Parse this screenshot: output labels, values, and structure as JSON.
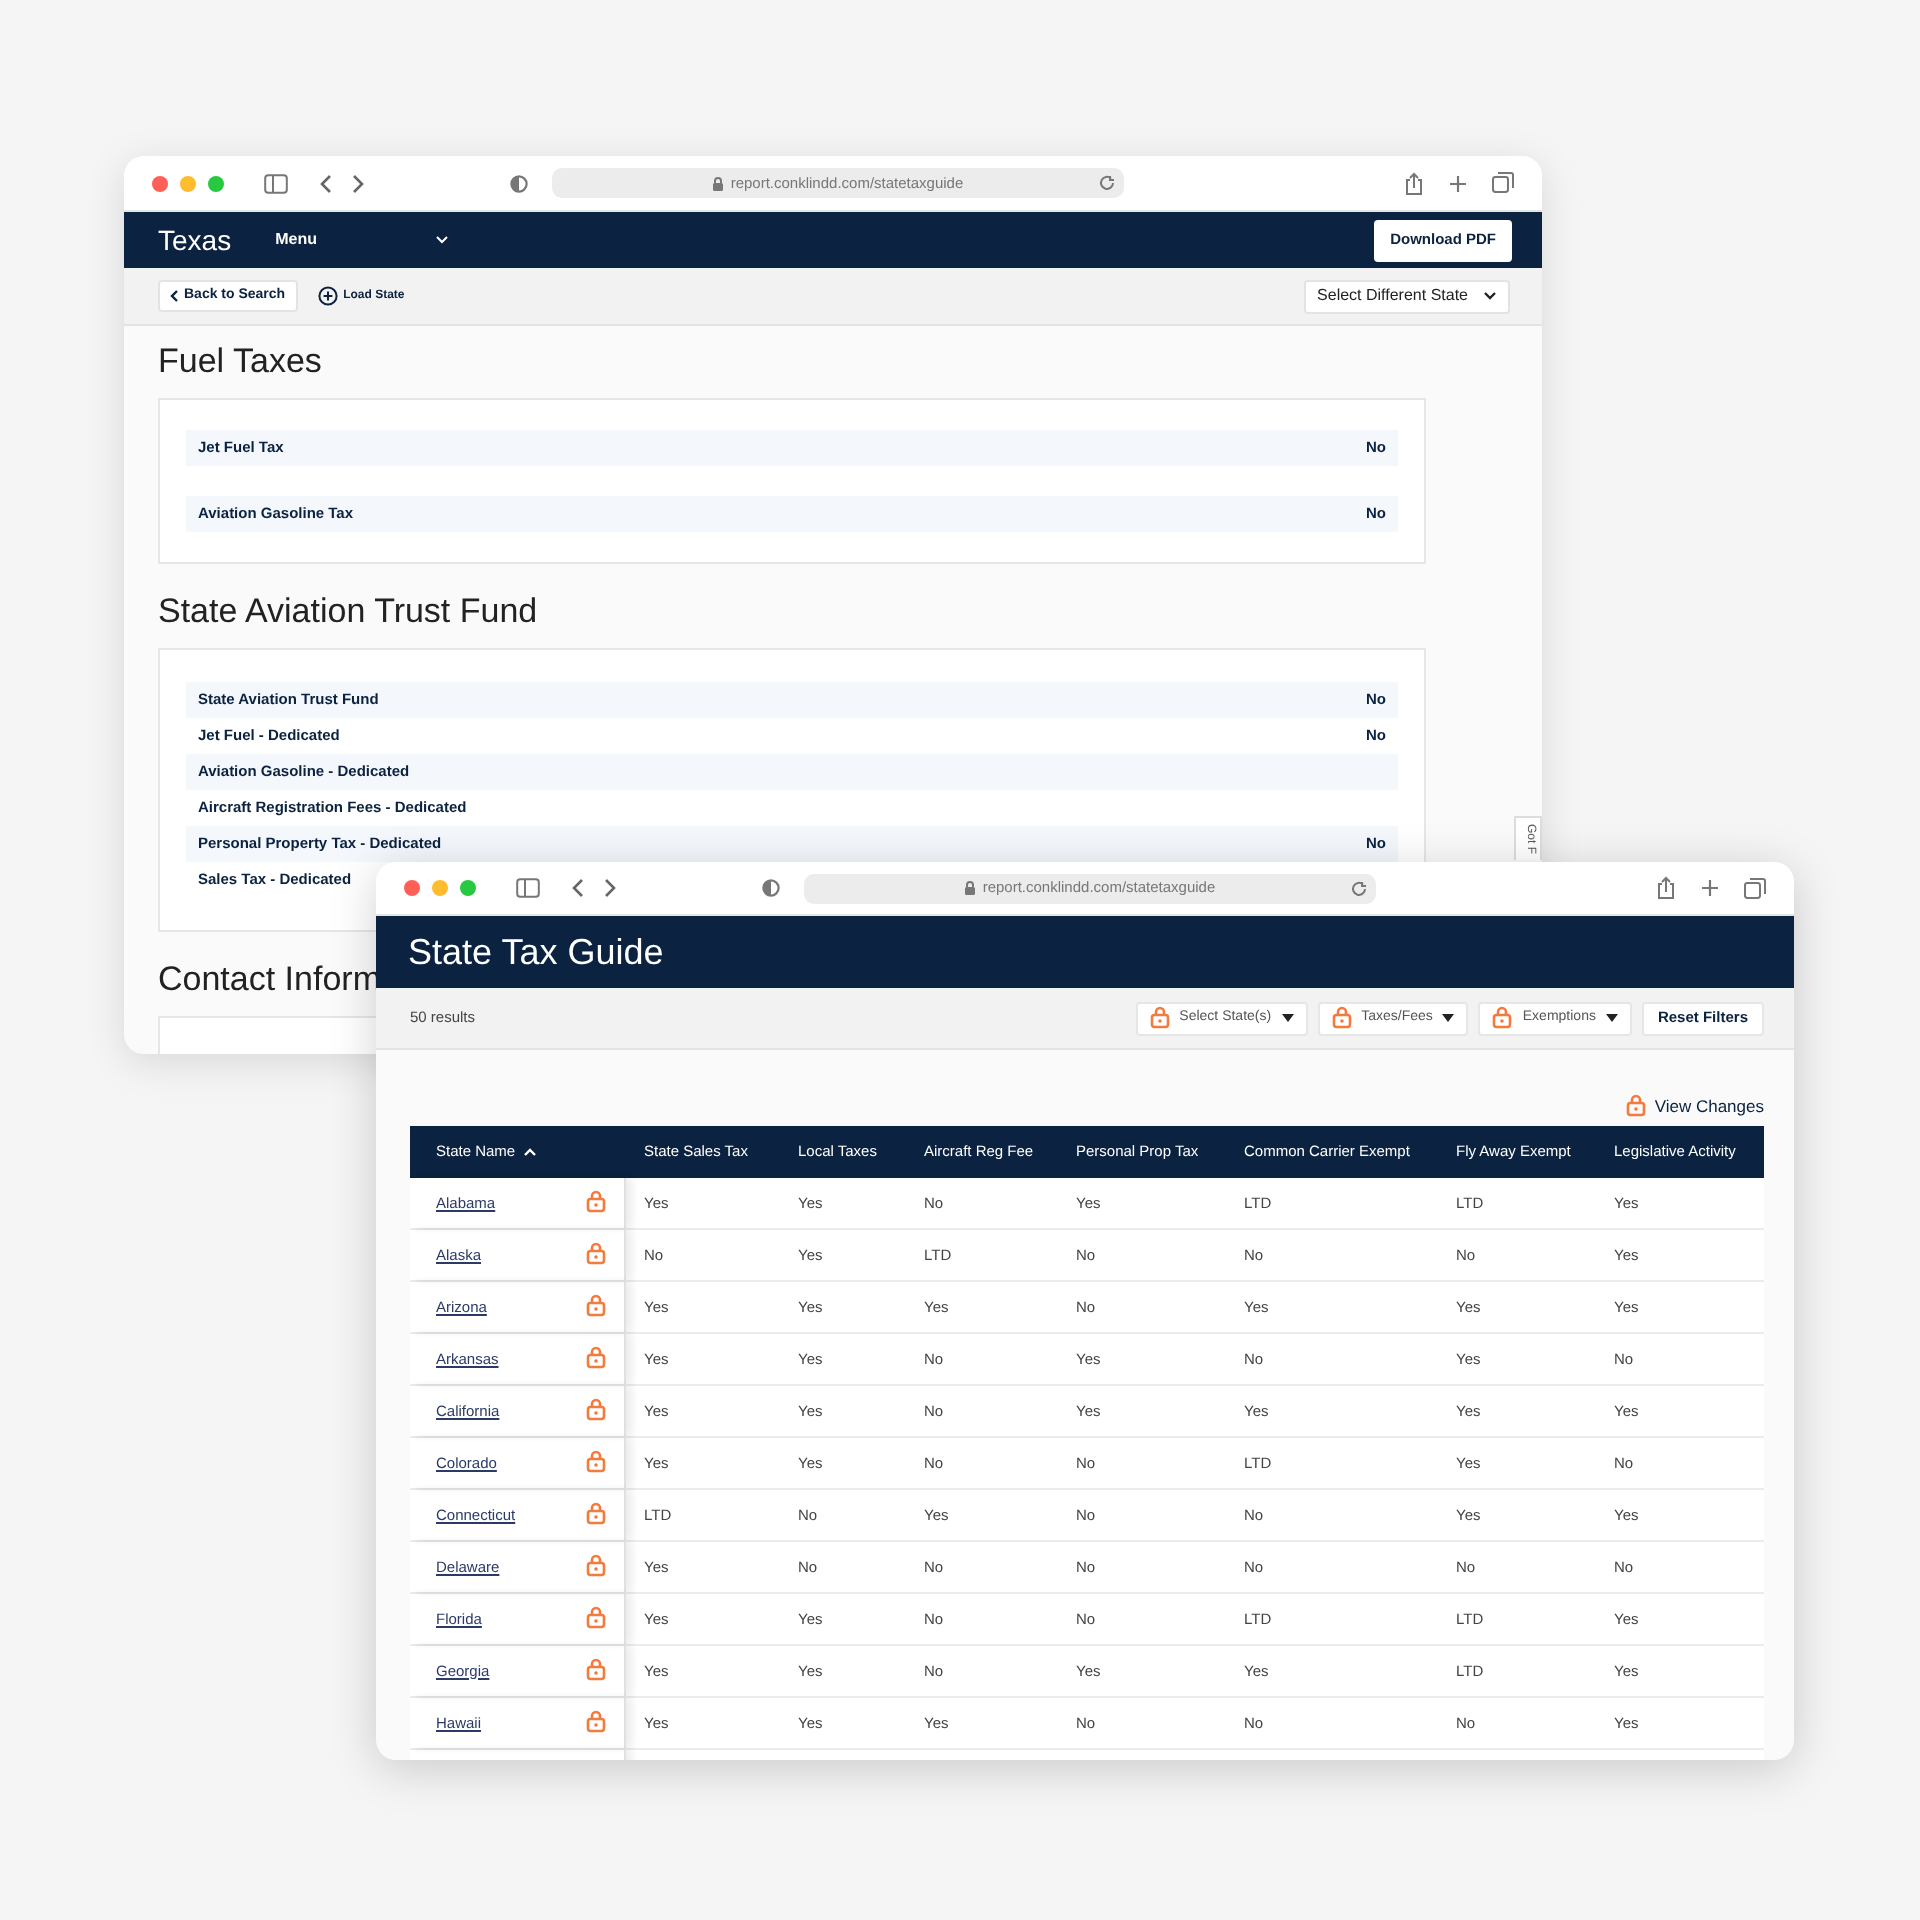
{
  "back_window": {
    "url": "report.conklindd.com/statetaxguide",
    "header": {
      "title": "Texas",
      "menu": "Menu",
      "download_button": "Download PDF"
    },
    "toolbar": {
      "back_button": "Back to Search",
      "load_button": "Load State",
      "state_select": "Select Different State"
    },
    "sections": [
      {
        "title": "Fuel Taxes",
        "rows": [
          {
            "label": "Jet Fuel Tax",
            "value": "No"
          },
          {
            "label": "Aviation Gasoline Tax",
            "value": "No"
          }
        ]
      },
      {
        "title": "State Aviation Trust Fund",
        "rows": [
          {
            "label": "State Aviation Trust Fund",
            "value": "No"
          },
          {
            "label": "Jet Fuel - Dedicated",
            "value": "No"
          },
          {
            "label": "Aviation Gasoline - Dedicated"
          },
          {
            "label": "Aircraft Registration Fees - Dedicated"
          },
          {
            "label": "Personal Property Tax - Dedicated",
            "value": "No"
          },
          {
            "label": "Sales Tax - Dedicated"
          }
        ]
      },
      {
        "title": "Contact Inform"
      }
    ],
    "side_tab": "Got F"
  },
  "front_window": {
    "url": "report.conklindd.com/statetaxguide",
    "title": "State Tax Guide",
    "results": "50 results",
    "filters": [
      "Select State(s)",
      "Taxes/Fees",
      "Exemptions"
    ],
    "reset_button": "Reset Filters",
    "view_changes": "View Changes",
    "table": {
      "columns": [
        {
          "label": "State Name",
          "sorted": true
        },
        {
          "label": "State Sales Tax",
          "sorted": false
        },
        {
          "label": "Local Taxes",
          "sorted": false
        },
        {
          "label": "Aircraft Reg Fee",
          "sorted": false
        },
        {
          "label": "Personal Prop Tax",
          "sorted": false
        },
        {
          "label": "Common Carrier Exempt",
          "sorted": false
        },
        {
          "label": "Fly Away Exempt",
          "sorted": false
        },
        {
          "label": "Legislative Activity",
          "sorted": false
        }
      ],
      "rows": [
        {
          "state": "Alabama",
          "values": [
            "Yes",
            "Yes",
            "No",
            "Yes",
            "LTD",
            "LTD",
            "Yes"
          ]
        },
        {
          "state": "Alaska",
          "values": [
            "No",
            "Yes",
            "LTD",
            "No",
            "No",
            "No",
            "Yes"
          ]
        },
        {
          "state": "Arizona",
          "values": [
            "Yes",
            "Yes",
            "Yes",
            "No",
            "Yes",
            "Yes",
            "Yes"
          ]
        },
        {
          "state": "Arkansas",
          "values": [
            "Yes",
            "Yes",
            "No",
            "Yes",
            "No",
            "Yes",
            "No"
          ]
        },
        {
          "state": "California",
          "values": [
            "Yes",
            "Yes",
            "No",
            "Yes",
            "Yes",
            "Yes",
            "Yes"
          ]
        },
        {
          "state": "Colorado",
          "values": [
            "Yes",
            "Yes",
            "No",
            "No",
            "LTD",
            "Yes",
            "No"
          ]
        },
        {
          "state": "Connecticut",
          "values": [
            "LTD",
            "No",
            "Yes",
            "No",
            "No",
            "Yes",
            "Yes"
          ]
        },
        {
          "state": "Delaware",
          "values": [
            "Yes",
            "No",
            "No",
            "No",
            "No",
            "No",
            "No"
          ]
        },
        {
          "state": "Florida",
          "values": [
            "Yes",
            "Yes",
            "No",
            "No",
            "LTD",
            "LTD",
            "Yes"
          ]
        },
        {
          "state": "Georgia",
          "values": [
            "Yes",
            "Yes",
            "No",
            "Yes",
            "Yes",
            "LTD",
            "Yes"
          ]
        },
        {
          "state": "Hawaii",
          "values": [
            "Yes",
            "Yes",
            "Yes",
            "No",
            "No",
            "No",
            "Yes"
          ]
        }
      ]
    }
  }
}
